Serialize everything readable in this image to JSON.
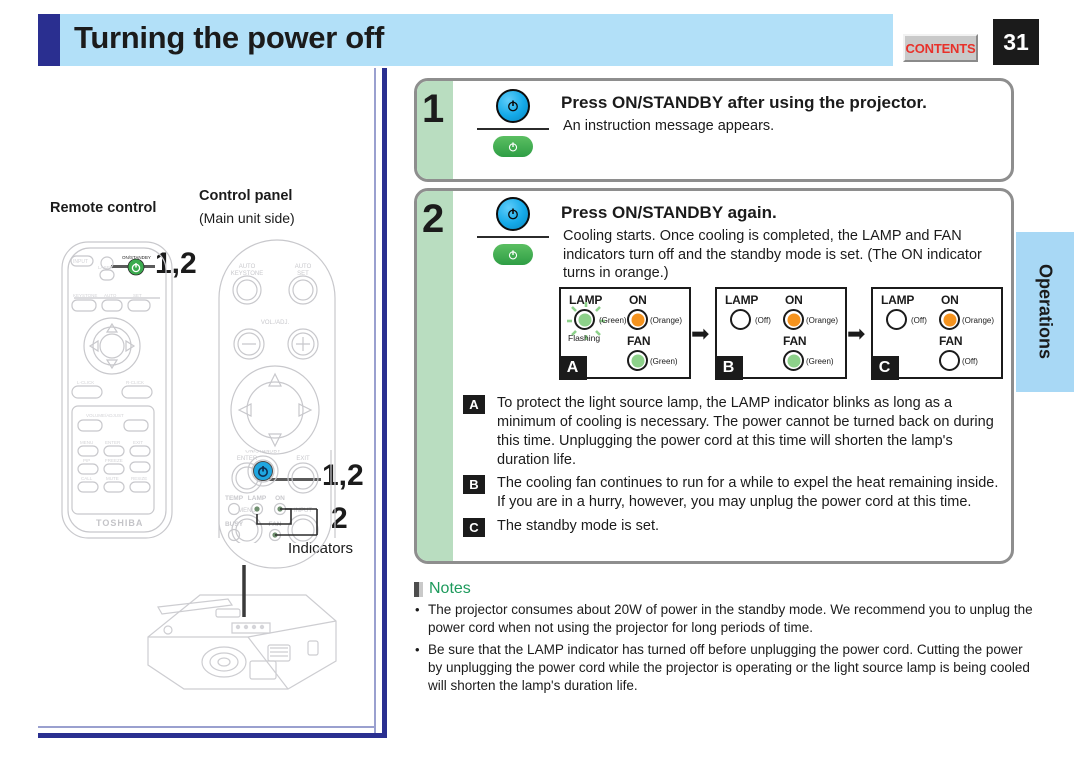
{
  "header": {
    "title": "Turning the power off",
    "contents_label": "CONTENTS",
    "page_number": "31",
    "side_tab": "Operations",
    "accent_blue": "#2a2f90",
    "band_blue": "#b2e0f8",
    "contents_red": "#e8312a"
  },
  "steps": [
    {
      "number": "1",
      "title": "Press ON/STANDBY after using the projector.",
      "subtitle": "An instruction message appears."
    },
    {
      "number": "2",
      "title": "Press ON/STANDBY again.",
      "subtitle": "Cooling starts. Once cooling is completed, the LAMP and FAN indicators turn off and the standby mode is set. (The ON indicator turns in orange.)"
    }
  ],
  "indicator_boxes": [
    {
      "tag": "A",
      "lamp_label": "LAMP",
      "lamp_state": "(Green)",
      "lamp_color": "green",
      "lamp_flashing": "Flashing",
      "on_label": "ON",
      "on_state": "(Orange)",
      "on_color": "orange",
      "fan_label": "FAN",
      "fan_state": "(Green)",
      "fan_color": "green"
    },
    {
      "tag": "B",
      "lamp_label": "LAMP",
      "lamp_state": "(Off)",
      "lamp_color": "off",
      "lamp_flashing": "",
      "on_label": "ON",
      "on_state": "(Orange)",
      "on_color": "orange",
      "fan_label": "FAN",
      "fan_state": "(Green)",
      "fan_color": "green"
    },
    {
      "tag": "C",
      "lamp_label": "LAMP",
      "lamp_state": "(Off)",
      "lamp_color": "off",
      "lamp_flashing": "",
      "on_label": "ON",
      "on_state": "(Orange)",
      "on_color": "orange",
      "fan_label": "FAN",
      "fan_state": "(Off)",
      "fan_color": "off"
    }
  ],
  "explanations": [
    {
      "tag": "A",
      "text": "To protect the light source lamp, the LAMP indicator blinks as long as a minimum of cooling is necessary. The power cannot be turned back on during this time. Unplugging the power cord at this time will shorten the lamp's duration life."
    },
    {
      "tag": "B",
      "text": "The cooling fan continues to run for a while to expel the heat remaining inside. If you are in a hurry, however, you may unplug the power cord at this time."
    },
    {
      "tag": "C",
      "text": "The standby mode is set."
    }
  ],
  "notes": {
    "heading": "Notes",
    "items": [
      "The projector consumes about 20W of power in the standby mode. We recommend you to unplug the power cord when not using the projector for long periods of time.",
      "Be sure that the LAMP indicator has turned off before unplugging the power cord. Cutting the power by unplugging the power cord while the projector is operating or the light source lamp is being cooled will shorten the lamp's duration life."
    ]
  },
  "illustrations": {
    "remote_label": "Remote control",
    "panel_label": "Control panel",
    "panel_sublabel": "(Main unit side)",
    "indicators_label": "Indicators",
    "callout_remote": "1,2",
    "callout_panel": "1,2",
    "callout_indicators": "2",
    "remote_buttons": {
      "input": "INPUT",
      "on_standby": "ON/STANDBY",
      "laser": "LASER",
      "keystone": "KEYSTONE",
      "auto": "AUTO",
      "set": "SET",
      "l_click": "L-CLICK",
      "r_click": "R-CLICK",
      "volume_adjust": "VOLUME/ADJUST",
      "menu": "MENU",
      "enter": "ENTER",
      "exit": "EXIT",
      "pip": "PIP",
      "freeze": "FREEZE",
      "call": "CALL",
      "mute": "MUTE",
      "resize": "RESIZE",
      "brand": "TOSHIBA"
    },
    "panel_buttons": {
      "auto_keystone": "AUTO KEYSTONE",
      "auto_set": "AUTO SET",
      "vol_adj": "VOL/ADJ.",
      "minus": "–",
      "plus": "+",
      "enter": "ENTER",
      "exit": "EXIT",
      "menu": "MENU",
      "input": "INPUT",
      "on_standby": "ON/STANDBY",
      "temp": "TEMP",
      "lamp": "LAMP",
      "on": "ON",
      "busy": "BUSY",
      "fan": "FAN"
    }
  }
}
